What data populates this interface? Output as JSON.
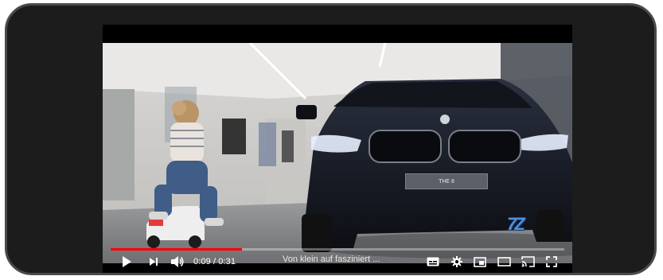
{
  "player": {
    "current_time": "0:09",
    "duration": "0:31",
    "time_separator": " / ",
    "progress_fraction": 0.29,
    "video_title": "Von klein auf fasziniert ...",
    "plate_text": "THE 8",
    "channel_badge": "7Z",
    "accent_color": "#ff0000",
    "controls": [
      "play-icon",
      "next-icon",
      "volume-icon",
      "subtitles-icon",
      "settings-icon",
      "miniplayer-icon",
      "theater-icon",
      "cast-icon",
      "fullscreen-icon"
    ]
  }
}
